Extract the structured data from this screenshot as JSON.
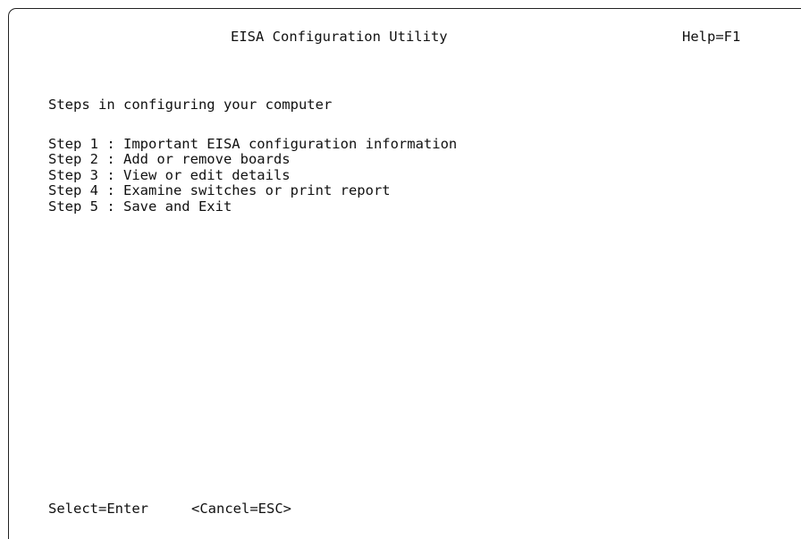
{
  "header": {
    "title": "EISA Configuration Utility",
    "help_hint": "Help=F1"
  },
  "main": {
    "subtitle": "Steps in configuring your computer",
    "steps": [
      {
        "label": "Step 1 : Important EISA configuration information"
      },
      {
        "label": "Step 2 : Add or remove boards"
      },
      {
        "label": "Step 3 : View or edit details"
      },
      {
        "label": "Step 4 : Examine switches or print report"
      },
      {
        "label": "Step 5 : Save and Exit"
      }
    ]
  },
  "footer": {
    "select_hint": "Select=Enter",
    "cancel_hint": "<Cancel=ESC>"
  }
}
